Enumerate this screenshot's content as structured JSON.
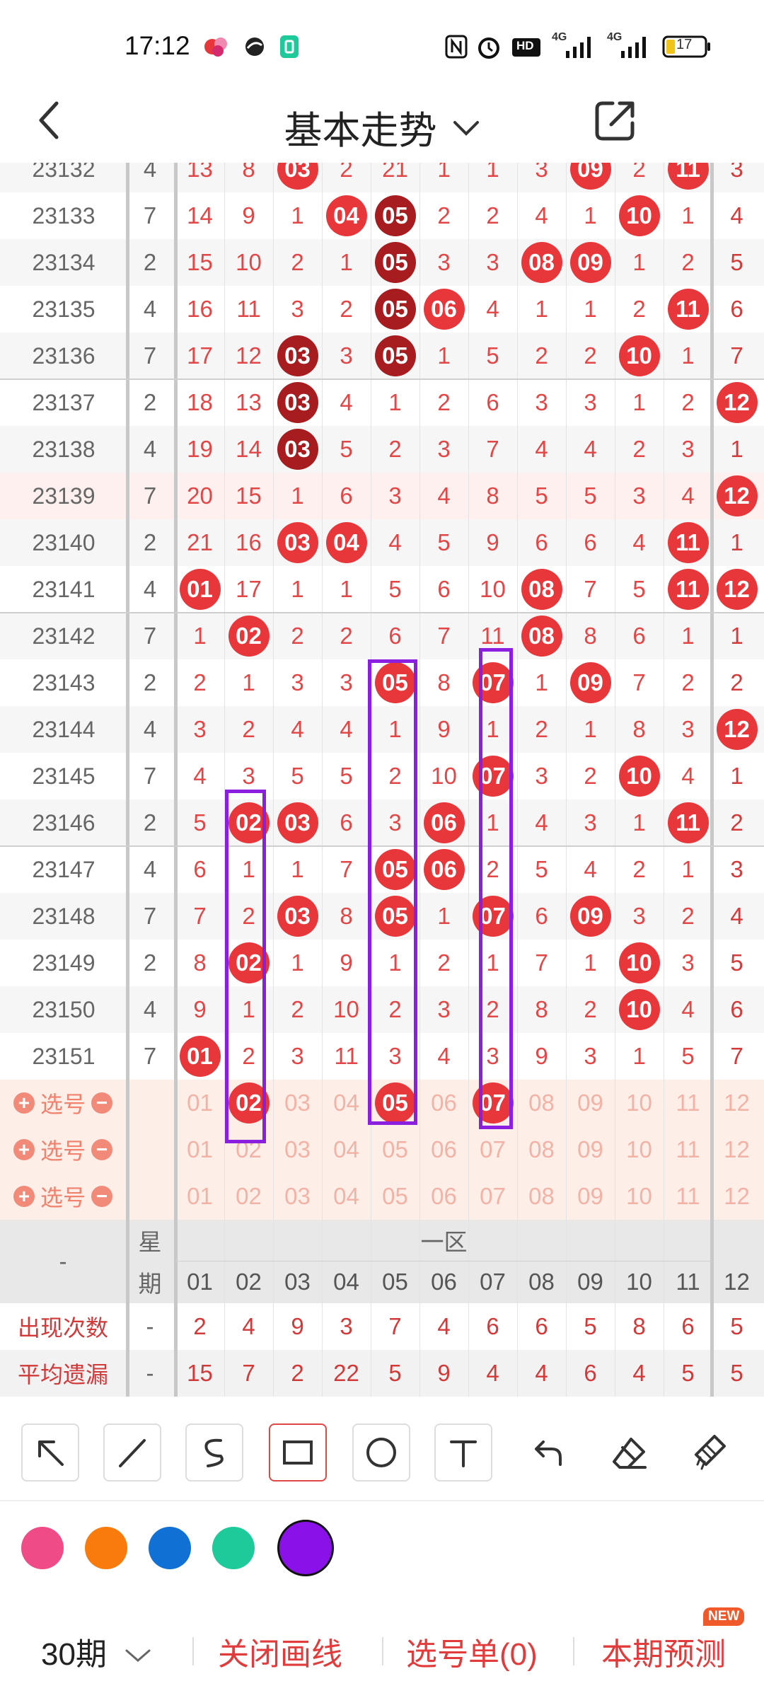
{
  "status_bar": {
    "time": "17:12",
    "battery": "17",
    "network_1": "4G",
    "network_2": "4G",
    "hd_label": "HD"
  },
  "header": {
    "title": "基本走势"
  },
  "columns": [
    "01",
    "02",
    "03",
    "04",
    "05",
    "06",
    "07",
    "08",
    "09",
    "10",
    "11",
    "12"
  ],
  "rows": [
    {
      "issue": "23132",
      "week": "4",
      "cells": [
        13,
        8,
        {
          "b": "03",
          "c": "red"
        },
        2,
        21,
        1,
        1,
        3,
        {
          "b": "09",
          "c": "red"
        },
        2,
        {
          "b": "11",
          "c": "red"
        },
        3
      ]
    },
    {
      "issue": "23133",
      "week": "7",
      "cells": [
        14,
        9,
        1,
        {
          "b": "04",
          "c": "red"
        },
        {
          "b": "05",
          "c": "dark"
        },
        2,
        2,
        4,
        1,
        {
          "b": "10",
          "c": "red"
        },
        1,
        4
      ]
    },
    {
      "issue": "23134",
      "week": "2",
      "cells": [
        15,
        10,
        2,
        1,
        {
          "b": "05",
          "c": "dark"
        },
        3,
        3,
        {
          "b": "08",
          "c": "red"
        },
        {
          "b": "09",
          "c": "red"
        },
        1,
        2,
        5
      ]
    },
    {
      "issue": "23135",
      "week": "4",
      "cells": [
        16,
        11,
        3,
        2,
        {
          "b": "05",
          "c": "dark"
        },
        {
          "b": "06",
          "c": "red"
        },
        4,
        1,
        1,
        2,
        {
          "b": "11",
          "c": "red"
        },
        6
      ]
    },
    {
      "issue": "23136",
      "week": "7",
      "cells": [
        17,
        12,
        {
          "b": "03",
          "c": "dark"
        },
        3,
        {
          "b": "05",
          "c": "dark"
        },
        1,
        5,
        2,
        2,
        {
          "b": "10",
          "c": "red"
        },
        1,
        7
      ]
    },
    {
      "issue": "23137",
      "week": "2",
      "cells": [
        18,
        13,
        {
          "b": "03",
          "c": "dark"
        },
        4,
        1,
        2,
        6,
        3,
        3,
        1,
        2,
        {
          "b": "12",
          "c": "red"
        }
      ]
    },
    {
      "issue": "23138",
      "week": "4",
      "cells": [
        19,
        14,
        {
          "b": "03",
          "c": "dark"
        },
        5,
        2,
        3,
        7,
        4,
        4,
        2,
        3,
        1
      ]
    },
    {
      "issue": "23139",
      "week": "7",
      "cells": [
        20,
        15,
        1,
        6,
        3,
        4,
        8,
        5,
        5,
        3,
        4,
        {
          "b": "12",
          "c": "red"
        }
      ]
    },
    {
      "issue": "23140",
      "week": "2",
      "cells": [
        21,
        16,
        {
          "b": "03",
          "c": "red"
        },
        {
          "b": "04",
          "c": "red"
        },
        4,
        5,
        9,
        6,
        6,
        4,
        {
          "b": "11",
          "c": "red"
        },
        1
      ]
    },
    {
      "issue": "23141",
      "week": "4",
      "cells": [
        {
          "b": "01",
          "c": "red"
        },
        17,
        1,
        1,
        5,
        6,
        10,
        {
          "b": "08",
          "c": "red"
        },
        7,
        5,
        {
          "b": "11",
          "c": "red"
        },
        {
          "b": "12",
          "c": "red"
        }
      ]
    },
    {
      "issue": "23142",
      "week": "7",
      "cells": [
        1,
        {
          "b": "02",
          "c": "red"
        },
        2,
        2,
        6,
        7,
        11,
        {
          "b": "08",
          "c": "red"
        },
        8,
        6,
        1,
        1
      ]
    },
    {
      "issue": "23143",
      "week": "2",
      "cells": [
        2,
        1,
        3,
        3,
        {
          "b": "05",
          "c": "red"
        },
        8,
        {
          "b": "07",
          "c": "red"
        },
        1,
        {
          "b": "09",
          "c": "red"
        },
        7,
        2,
        2
      ]
    },
    {
      "issue": "23144",
      "week": "4",
      "cells": [
        3,
        2,
        4,
        4,
        1,
        9,
        1,
        2,
        1,
        8,
        3,
        {
          "b": "12",
          "c": "red"
        }
      ]
    },
    {
      "issue": "23145",
      "week": "7",
      "cells": [
        4,
        3,
        5,
        5,
        2,
        10,
        {
          "b": "07",
          "c": "red"
        },
        3,
        2,
        {
          "b": "10",
          "c": "red"
        },
        4,
        1
      ]
    },
    {
      "issue": "23146",
      "week": "2",
      "cells": [
        5,
        {
          "b": "02",
          "c": "red"
        },
        {
          "b": "03",
          "c": "red"
        },
        6,
        3,
        {
          "b": "06",
          "c": "red"
        },
        1,
        4,
        3,
        1,
        {
          "b": "11",
          "c": "red"
        },
        2
      ]
    },
    {
      "issue": "23147",
      "week": "4",
      "cells": [
        6,
        1,
        1,
        7,
        {
          "b": "05",
          "c": "red"
        },
        {
          "b": "06",
          "c": "red"
        },
        2,
        5,
        4,
        2,
        1,
        3
      ]
    },
    {
      "issue": "23148",
      "week": "7",
      "cells": [
        7,
        2,
        {
          "b": "03",
          "c": "red"
        },
        8,
        {
          "b": "05",
          "c": "red"
        },
        1,
        {
          "b": "07",
          "c": "red"
        },
        6,
        {
          "b": "09",
          "c": "red"
        },
        3,
        2,
        4
      ]
    },
    {
      "issue": "23149",
      "week": "2",
      "cells": [
        8,
        {
          "b": "02",
          "c": "red"
        },
        1,
        9,
        1,
        2,
        1,
        7,
        1,
        {
          "b": "10",
          "c": "red"
        },
        3,
        5
      ]
    },
    {
      "issue": "23150",
      "week": "4",
      "cells": [
        9,
        1,
        2,
        10,
        2,
        3,
        2,
        8,
        2,
        {
          "b": "10",
          "c": "red"
        },
        4,
        6
      ]
    },
    {
      "issue": "23151",
      "week": "7",
      "cells": [
        {
          "b": "01",
          "c": "red"
        },
        2,
        3,
        11,
        3,
        4,
        3,
        9,
        3,
        1,
        5,
        7
      ]
    }
  ],
  "pick_rows": [
    {
      "label": "选号",
      "selected": [
        "02",
        "05",
        "07"
      ]
    },
    {
      "label": "选号",
      "selected": []
    },
    {
      "label": "选号",
      "selected": []
    }
  ],
  "footer_header": {
    "dash": "-",
    "week_top": "星",
    "week_bottom": "期",
    "zone": "一区"
  },
  "stats": [
    {
      "label": "出现次数",
      "week": "-",
      "values": [
        2,
        4,
        9,
        3,
        7,
        4,
        6,
        6,
        5,
        8,
        6,
        5
      ]
    },
    {
      "label": "平均遗漏",
      "week": "-",
      "values": [
        15,
        7,
        2,
        22,
        5,
        9,
        4,
        4,
        6,
        4,
        5,
        5
      ]
    }
  ],
  "tools": [
    "arrow-tool",
    "line-tool",
    "curve-tool",
    "rectangle-tool",
    "circle-tool",
    "text-tool",
    "undo-tool",
    "eraser-tool",
    "clear-tool"
  ],
  "palette": [
    "#ef4b86",
    "#f97b0c",
    "#1170d4",
    "#1ec99a",
    "#8a12e8"
  ],
  "colors": {
    "red": "#e8373b",
    "dark": "#a61c1f",
    "pick_bg": "#fdeee8",
    "stripe": "#f6f6f6",
    "pink_row": "#fdf0ef",
    "footer_bg": "#e8e8e8",
    "purple": "#8a1fe0"
  },
  "bottom_bar": {
    "period": "30期",
    "close_lines": "关闭画线",
    "pick_list": "选号单(0)",
    "predict": "本期预测",
    "new_badge": "NEW"
  }
}
